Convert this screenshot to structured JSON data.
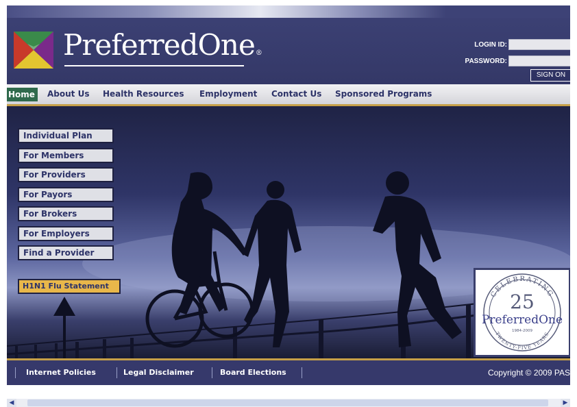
{
  "brand": {
    "name": "PreferredOne",
    "reg": "®"
  },
  "login": {
    "id_label": "LOGIN ID:",
    "password_label": "PASSWORD:",
    "id_value": "",
    "password_value": "",
    "sign_on": "SIGN ON"
  },
  "nav": {
    "items": [
      "Home",
      "About Us",
      "Health Resources",
      "Employment",
      "Contact Us",
      "Sponsored Programs"
    ]
  },
  "sidebar": {
    "items": [
      "Individual Plan",
      "For Members",
      "For Providers",
      "For Payors",
      "For Brokers",
      "For Employers",
      "Find a Provider"
    ]
  },
  "flu": {
    "label": "H1N1 Flu Statement"
  },
  "badge": {
    "top_text": "CELEBRATING",
    "number": "25",
    "brand": "PreferredOne",
    "years": "1984-2009",
    "bottom_text": "TWENTY-FIVE YEARS"
  },
  "footer": {
    "links": [
      "Internet Policies",
      "Legal Disclaimer",
      "Board Elections"
    ],
    "copyright": "Copyright © 2009 PAS"
  },
  "colors": {
    "header_bg": "#34386a",
    "nav_bg": "#dcdde2",
    "gold": "#c6a048",
    "home_bg": "#2f6a4c",
    "text_navy": "#2d3368",
    "flu_bg": "#e8b74a"
  },
  "icons": [
    "logo-mark-icon",
    "scroll-left-icon",
    "scroll-right-icon"
  ]
}
